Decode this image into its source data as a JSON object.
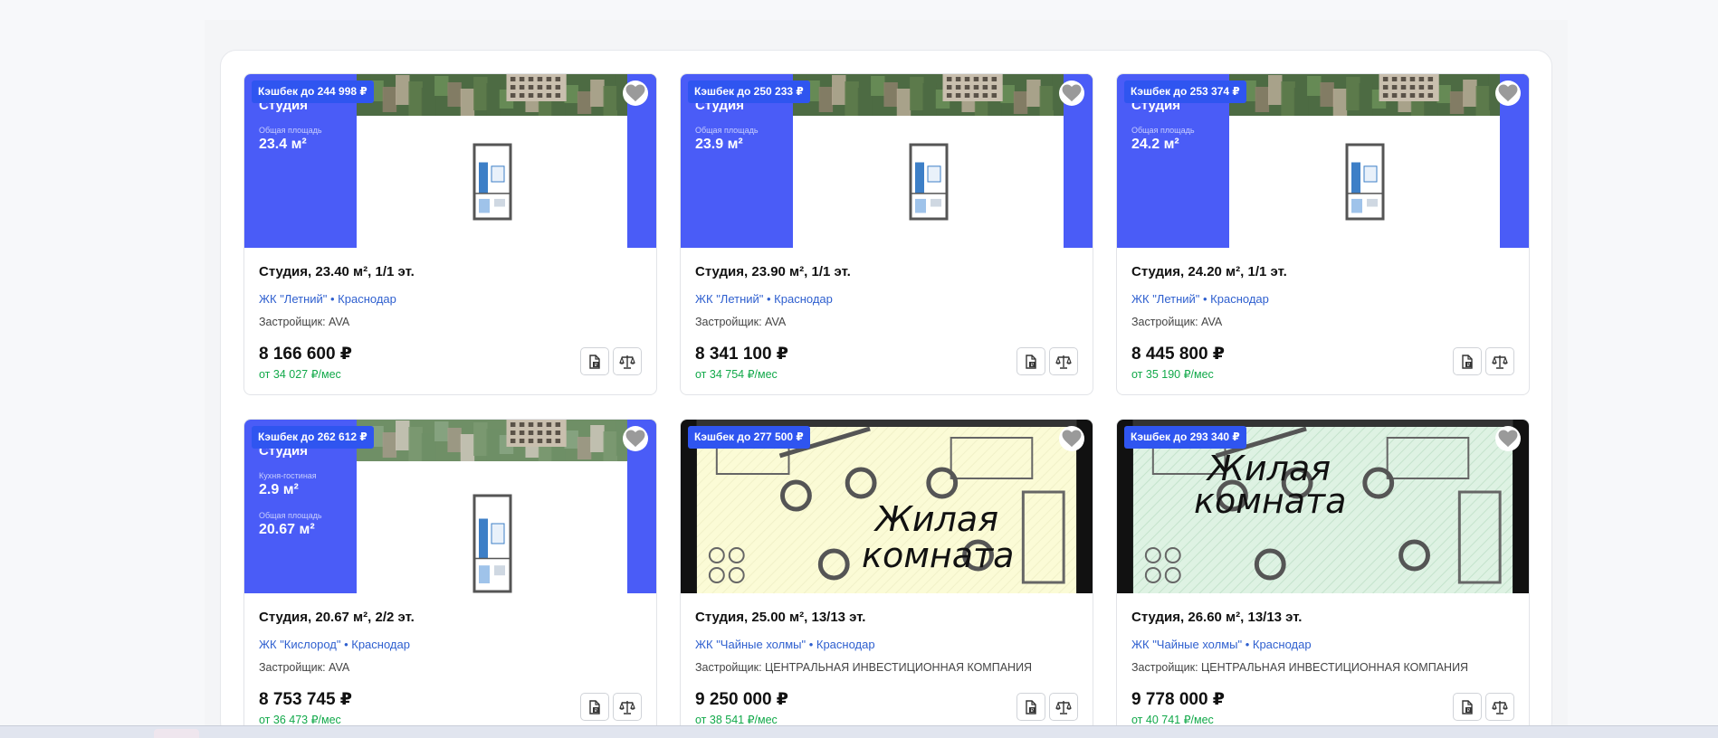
{
  "cards": [
    {
      "cashback": "Кэшбек до 244 998 ₽",
      "media": {
        "kind": "promo",
        "room_type": "Студия",
        "area1_caption": "Общая площадь",
        "area1_value": "23.4 м²"
      },
      "title": "Студия, 23.40 м², 1/1 эт.",
      "location": "ЖК \"Летний\" • Краснодар",
      "developer": "Застройщик: AVA",
      "price": "8 166 600 ₽",
      "monthly": "от 34 027 ₽/мес"
    },
    {
      "cashback": "Кэшбек до 250 233 ₽",
      "media": {
        "kind": "promo",
        "room_type": "Студия",
        "area1_caption": "Общая площадь",
        "area1_value": "23.9 м²"
      },
      "title": "Студия, 23.90 м², 1/1 эт.",
      "location": "ЖК \"Летний\" • Краснодар",
      "developer": "Застройщик: AVA",
      "price": "8 341 100 ₽",
      "monthly": "от 34 754 ₽/мес"
    },
    {
      "cashback": "Кэшбек до 253 374 ₽",
      "media": {
        "kind": "promo",
        "room_type": "Студия",
        "area1_caption": "Общая площадь",
        "area1_value": "24.2 м²"
      },
      "title": "Студия, 24.20 м², 1/1 эт.",
      "location": "ЖК \"Летний\" • Краснодар",
      "developer": "Застройщик: AVA",
      "price": "8 445 800 ₽",
      "monthly": "от 35 190 ₽/мес"
    },
    {
      "cashback": "Кэшбек до 262 612 ₽",
      "media": {
        "kind": "promo",
        "room_type": "Студия",
        "area1_caption": "Кухня-гостиная",
        "area1_value": "2.9 м²",
        "area2_caption": "Общая площадь",
        "area2_value": "20.67 м²"
      },
      "title": "Студия, 20.67 м², 2/2 эт.",
      "location": "ЖК \"Кислород\" • Краснодар",
      "developer": "Застройщик: AVA",
      "price": "8 753 745 ₽",
      "monthly": "от 36 473 ₽/мес"
    },
    {
      "cashback": "Кэшбек до 277 500 ₽",
      "media": {
        "kind": "photo",
        "plan_label_1": "Жилая",
        "plan_label_2": "комната",
        "bg": "#fbfbd6"
      },
      "title": "Студия, 25.00 м², 13/13 эт.",
      "location": "ЖК \"Чайные холмы\" • Краснодар",
      "developer": "Застройщик: ЦЕНТРАЛЬНАЯ ИНВЕСТИЦИОННАЯ КОМПАНИЯ",
      "price": "9 250 000 ₽",
      "monthly": "от 38 541 ₽/мес"
    },
    {
      "cashback": "Кэшбек до 293 340 ₽",
      "media": {
        "kind": "photo",
        "plan_label_1": "Жилая",
        "plan_label_2": "комната",
        "bg": "#def2e3"
      },
      "title": "Студия, 26.60 м², 13/13 эт.",
      "location": "ЖК \"Чайные холмы\" • Краснодар",
      "developer": "Застройщик: ЦЕНТРАЛЬНАЯ ИНВЕСТИЦИОННАЯ КОМПАНИЯ",
      "price": "9 778 000 ₽",
      "monthly": "от 40 741 ₽/мес"
    }
  ],
  "icons": {
    "favorite": "heart-icon",
    "document": "document-rub-icon",
    "compare": "scales-icon"
  },
  "colors": {
    "promo_blue": "#4a5cf7",
    "cashback_blue": "#2f55f0",
    "link_blue": "#2e5fcf",
    "monthly_green": "#12a94a"
  }
}
